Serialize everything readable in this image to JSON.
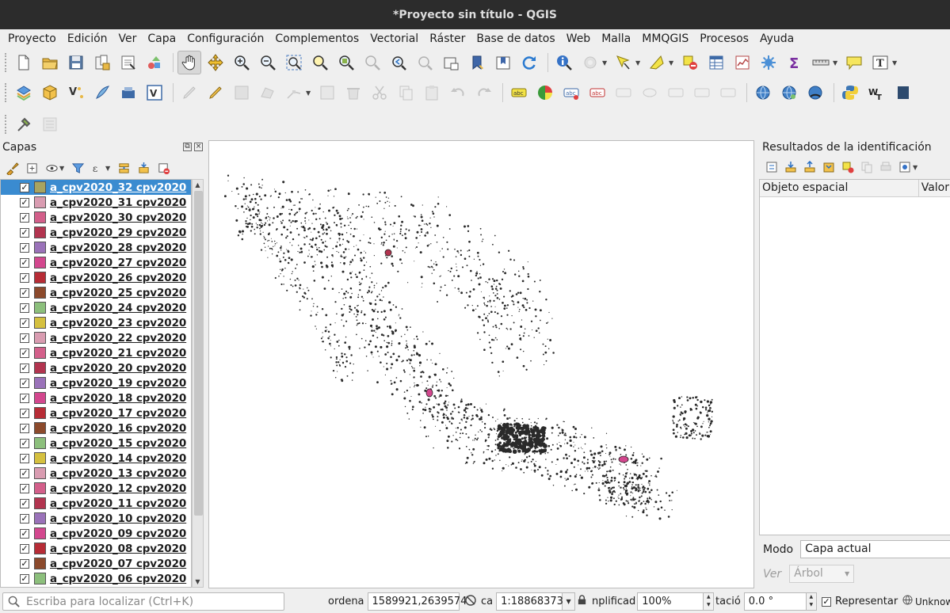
{
  "window": {
    "title": "*Proyecto sin título - QGIS"
  },
  "menu": [
    "Proyecto",
    "Edición",
    "Ver",
    "Capa",
    "Configuración",
    "Complementos",
    "Vectorial",
    "Ráster",
    "Base de datos",
    "Web",
    "Malla",
    "MMQGIS",
    "Procesos",
    "Ayuda"
  ],
  "layers_panel": {
    "title": "Capas",
    "layers": [
      {
        "name": "a_cpv2020_32 cpv2020",
        "color": "#a8a461",
        "selected": true
      },
      {
        "name": "a_cpv2020_31 cpv2020",
        "color": "#d99cb1"
      },
      {
        "name": "a_cpv2020_30 cpv2020",
        "color": "#d35f8a"
      },
      {
        "name": "a_cpv2020_29 cpv2020",
        "color": "#b2344f"
      },
      {
        "name": "a_cpv2020_28 cpv2020",
        "color": "#9a72b9"
      },
      {
        "name": "a_cpv2020_27 cpv2020",
        "color": "#d3478e"
      },
      {
        "name": "a_cpv2020_26 cpv2020",
        "color": "#b72c36"
      },
      {
        "name": "a_cpv2020_25 cpv2020",
        "color": "#8c4a2c"
      },
      {
        "name": "a_cpv2020_24 cpv2020",
        "color": "#8cbf7c"
      },
      {
        "name": "a_cpv2020_23 cpv2020",
        "color": "#d5c03f"
      },
      {
        "name": "a_cpv2020_22 cpv2020",
        "color": "#d99cb1"
      },
      {
        "name": "a_cpv2020_21 cpv2020",
        "color": "#d35f8a"
      },
      {
        "name": "a_cpv2020_20 cpv2020",
        "color": "#b2344f"
      },
      {
        "name": "a_cpv2020_19 cpv2020",
        "color": "#9a72b9"
      },
      {
        "name": "a_cpv2020_18 cpv2020",
        "color": "#d3478e"
      },
      {
        "name": "a_cpv2020_17 cpv2020",
        "color": "#b72c36"
      },
      {
        "name": "a_cpv2020_16 cpv2020",
        "color": "#8c4a2c"
      },
      {
        "name": "a_cpv2020_15 cpv2020",
        "color": "#8cbf7c"
      },
      {
        "name": "a_cpv2020_14 cpv2020",
        "color": "#d5c03f"
      },
      {
        "name": "a_cpv2020_13 cpv2020",
        "color": "#d99cb1"
      },
      {
        "name": "a_cpv2020_12 cpv2020",
        "color": "#d35f8a"
      },
      {
        "name": "a_cpv2020_11 cpv2020",
        "color": "#b2344f"
      },
      {
        "name": "a_cpv2020_10 cpv2020",
        "color": "#9a72b9"
      },
      {
        "name": "a_cpv2020_09 cpv2020",
        "color": "#d3478e"
      },
      {
        "name": "a_cpv2020_08 cpv2020",
        "color": "#b72c36"
      },
      {
        "name": "a_cpv2020_07 cpv2020",
        "color": "#8c4a2c"
      },
      {
        "name": "a_cpv2020_06 cpv2020",
        "color": "#8cbf7c"
      }
    ]
  },
  "identify_panel": {
    "title": "Resultados de la identificación",
    "col_feature": "Objeto espacial",
    "col_value": "Valor",
    "mode_label": "Modo",
    "mode_value": "Capa actual",
    "view_label": "Ver",
    "view_value": "Árbol"
  },
  "statusbar": {
    "locator_placeholder": "Escriba para localizar (Ctrl+K)",
    "coord_label": "ordena",
    "coord_value": "1589921,2639574",
    "scale_label": "ca",
    "scale_value": "1:18868373",
    "magnifier_label": "nplificad",
    "magnifier_value": "100%",
    "rotation_label": "tació",
    "rotation_value": "0.0 °",
    "render_label": "Representar",
    "crs_label": "Unknow"
  }
}
